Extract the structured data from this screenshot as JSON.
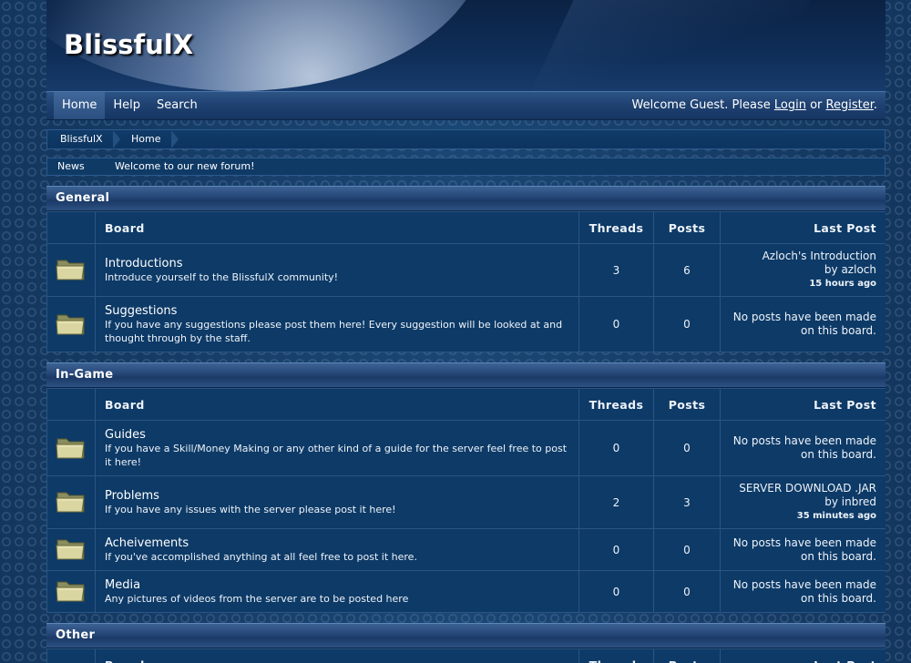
{
  "site": {
    "logo_text": "BlissfulX"
  },
  "nav": {
    "items": [
      "Home",
      "Help",
      "Search"
    ],
    "welcome_prefix": "Welcome Guest. Please ",
    "login": "Login",
    "or": " or ",
    "register": "Register",
    "period": "."
  },
  "breadcrumb": [
    "BlissfulX",
    "Home"
  ],
  "news": {
    "label": "News",
    "text": "Welcome to our new forum!"
  },
  "table_headers": {
    "board": "Board",
    "threads": "Threads",
    "posts": "Posts",
    "last_post": "Last Post"
  },
  "categories": [
    {
      "title": "General",
      "boards": [
        {
          "name": "Introductions",
          "desc": "Introduce yourself to the BlissfulX community!",
          "threads": "3",
          "posts": "6",
          "last": {
            "title": "Azloch's Introduction",
            "by": "by azloch",
            "when": "15 hours ago"
          }
        },
        {
          "name": "Suggestions",
          "desc": "If you have any suggestions please post them here! Every suggestion will be looked at and thought through by the staff.",
          "threads": "0",
          "posts": "0",
          "last": {
            "none1": "No posts have been made",
            "none2": "on this board."
          }
        }
      ]
    },
    {
      "title": "In-Game",
      "boards": [
        {
          "name": "Guides",
          "desc": "If you have a Skill/Money Making or any other kind of a guide for the server feel free to post it here!",
          "threads": "0",
          "posts": "0",
          "last": {
            "none1": "No posts have been made",
            "none2": "on this board."
          }
        },
        {
          "name": "Problems",
          "desc": "If you have any issues with the server please post it here!",
          "threads": "2",
          "posts": "3",
          "last": {
            "title": "SERVER DOWNLOAD .JAR",
            "by": "by inbred",
            "when": "35 minutes ago"
          }
        },
        {
          "name": "Acheivements",
          "desc": "If you've accomplished anything at all feel free to post it here.",
          "threads": "0",
          "posts": "0",
          "last": {
            "none1": "No posts have been made",
            "none2": "on this board."
          }
        },
        {
          "name": "Media",
          "desc": "Any pictures of videos from the server are to be posted here",
          "threads": "0",
          "posts": "0",
          "last": {
            "none1": "No posts have been made",
            "none2": "on this board."
          }
        }
      ]
    },
    {
      "title": "Other",
      "boards": []
    }
  ]
}
